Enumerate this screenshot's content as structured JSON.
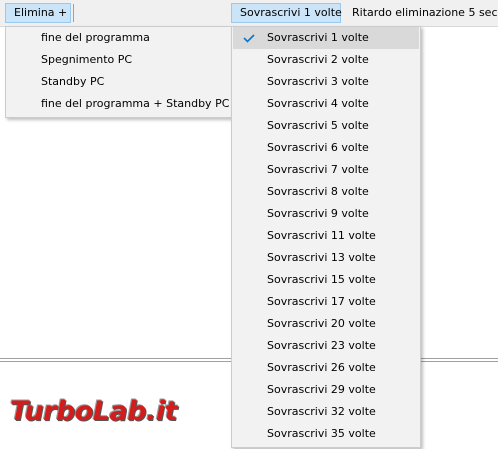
{
  "menubar": {
    "elimina_label": "Elimina +",
    "sovrascrivi_label": "Sovrascrivi 1 volte",
    "ritardo_label": "Ritardo eliminazione 5 sec"
  },
  "elimina_menu": {
    "items": [
      {
        "label": "fine del programma"
      },
      {
        "label": "Spegnimento PC"
      },
      {
        "label": "Standby PC"
      },
      {
        "label": "fine del programma + Standby PC"
      }
    ]
  },
  "sovrascrivi_menu": {
    "selected": "Sovrascrivi 1 volte",
    "items": [
      {
        "label": "Sovrascrivi 1 volte",
        "checked": true
      },
      {
        "label": "Sovrascrivi 2 volte"
      },
      {
        "label": "Sovrascrivi 3 volte"
      },
      {
        "label": "Sovrascrivi 4 volte"
      },
      {
        "label": "Sovrascrivi 5 volte"
      },
      {
        "label": "Sovrascrivi 6 volte"
      },
      {
        "label": "Sovrascrivi 7 volte"
      },
      {
        "label": "Sovrascrivi 8 volte"
      },
      {
        "label": "Sovrascrivi 9 volte"
      },
      {
        "label": "Sovrascrivi 11 volte"
      },
      {
        "label": "Sovrascrivi 13 volte"
      },
      {
        "label": "Sovrascrivi 15 volte"
      },
      {
        "label": "Sovrascrivi 17 volte"
      },
      {
        "label": "Sovrascrivi 20 volte"
      },
      {
        "label": "Sovrascrivi 23 volte"
      },
      {
        "label": "Sovrascrivi 26 volte"
      },
      {
        "label": "Sovrascrivi 29 volte"
      },
      {
        "label": "Sovrascrivi 32 volte"
      },
      {
        "label": "Sovrascrivi 35 volte"
      }
    ]
  },
  "watermark": {
    "text": "TurboLab.it",
    "color": "#d31d1d"
  },
  "colors": {
    "menu_bg": "#f2f2f2",
    "active_bg": "#cce4f7",
    "check": "#0078d7"
  },
  "icons": {
    "check": "checkmark-icon"
  }
}
